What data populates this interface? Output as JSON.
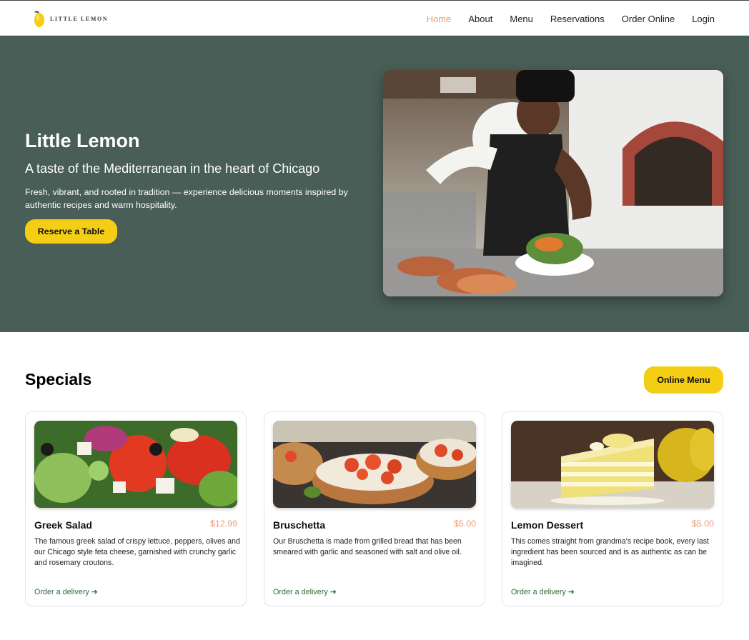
{
  "brand": {
    "name": "Little Lemon",
    "logo_icon": "lemon-icon",
    "accent": "#f4ce14",
    "highlight": "#ee9972",
    "hero_bg": "#495e57"
  },
  "nav": {
    "items": [
      {
        "label": "Home",
        "active": true
      },
      {
        "label": "About"
      },
      {
        "label": "Menu"
      },
      {
        "label": "Reservations"
      },
      {
        "label": "Order Online"
      },
      {
        "label": "Login"
      }
    ]
  },
  "hero": {
    "title": "Little Lemon",
    "subtitle": "A taste of the Mediterranean in the heart of Chicago",
    "description": "Fresh, vibrant, and rooted in tradition — experience delicious moments inspired by authentic recipes and warm hospitality.",
    "cta_label": "Reserve a Table"
  },
  "specials": {
    "title": "Specials",
    "menu_button_label": "Online Menu",
    "cards": [
      {
        "name": "Greek Salad",
        "price": "$12.99",
        "description": "The famous greek salad of crispy lettuce, peppers, olives and our Chicago style feta cheese, garnished with crunchy garlic and rosemary croutons.",
        "link": "Order a delivery ➜"
      },
      {
        "name": "Bruschetta",
        "price": "$5.00",
        "description": "Our Bruschetta is made from grilled bread that has been smeared with garlic and seasoned with salt and olive oil.",
        "link": "Order a delivery ➜"
      },
      {
        "name": "Lemon Dessert",
        "price": "$5.00",
        "description": "This comes straight from grandma's recipe book, every last ingredient has been sourced and is as authentic as can be imagined.",
        "link": "Order a delivery ➜"
      }
    ]
  }
}
